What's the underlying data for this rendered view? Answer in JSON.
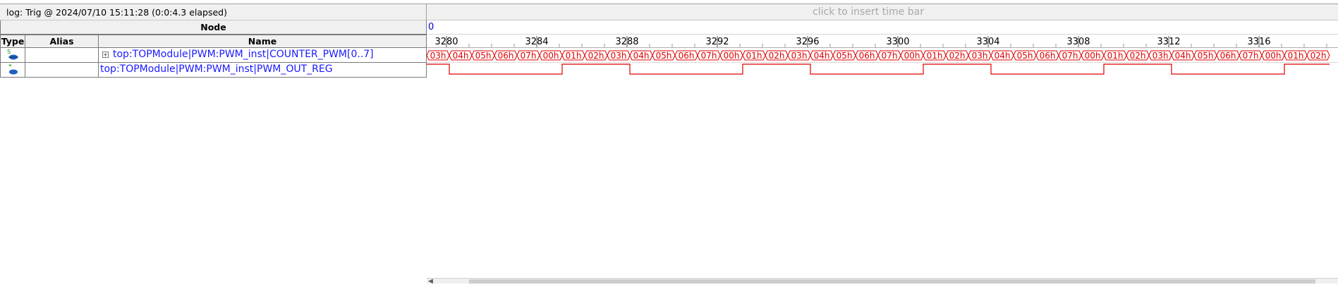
{
  "log_title": "log: Trig @ 2024/07/10 15:11:28 (0:0:4.3 elapsed)",
  "timebar_hint": "click to insert time bar",
  "time_origin": "0",
  "header": {
    "node": "Node",
    "type": "Type",
    "alias": "Alias",
    "name": "Name"
  },
  "ruler_ticks": [
    "3280",
    "3284",
    "3288",
    "3292",
    "3296",
    "3300",
    "3304",
    "3308",
    "3312",
    "3316"
  ],
  "signals": [
    {
      "expand": "+",
      "name": "top:TOPModule|PWM:PWM_inst|COUNTER_PWM[0..7]",
      "type_icon": "bus-icon"
    },
    {
      "name": "top:TOPModule|PWM:PWM_inst|PWM_OUT_REG",
      "type_icon": "register-icon"
    }
  ],
  "counter_values": [
    "03h",
    "04h",
    "05h",
    "06h",
    "07h",
    "00h",
    "01h",
    "02h",
    "03h",
    "04h",
    "05h",
    "06h",
    "07h",
    "00h",
    "01h",
    "02h",
    "03h",
    "04h",
    "05h",
    "06h",
    "07h",
    "00h",
    "01h",
    "02h",
    "03h",
    "04h",
    "05h",
    "06h",
    "07h",
    "00h",
    "01h",
    "02h",
    "03h",
    "04h",
    "05h",
    "06h",
    "07h",
    "00h",
    "01h",
    "02h"
  ],
  "pwm_levels": [
    1,
    0,
    0,
    0,
    0,
    0,
    1,
    1,
    1,
    0,
    0,
    0,
    0,
    0,
    1,
    1,
    1,
    0,
    0,
    0,
    0,
    0,
    1,
    1,
    1,
    0,
    0,
    0,
    0,
    0,
    1,
    1,
    1,
    0,
    0,
    0,
    0,
    0,
    1,
    1
  ],
  "colors": {
    "wave": "#e00000",
    "signal_text": "#1a1aff",
    "header_bg": "#f0f0f0"
  }
}
